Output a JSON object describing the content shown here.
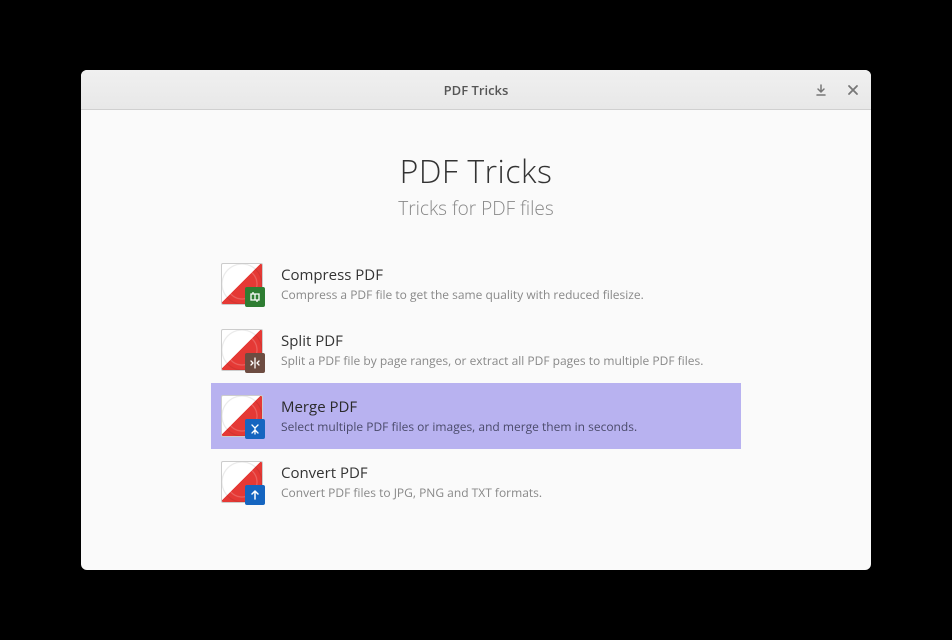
{
  "titlebar": {
    "title": "PDF Tricks"
  },
  "hero": {
    "title": "PDF Tricks",
    "subtitle": "Tricks for PDF files"
  },
  "options": [
    {
      "title": "Compress PDF",
      "desc": "Compress a PDF file to get the same quality with reduced filesize.",
      "selected": false
    },
    {
      "title": "Split PDF",
      "desc": "Split a PDF file by page ranges, or extract all PDF pages to multiple PDF files.",
      "selected": false
    },
    {
      "title": "Merge PDF",
      "desc": "Select multiple PDF files or images, and merge them in seconds.",
      "selected": true
    },
    {
      "title": "Convert PDF",
      "desc": "Convert PDF files to JPG, PNG and TXT formats.",
      "selected": false
    }
  ]
}
